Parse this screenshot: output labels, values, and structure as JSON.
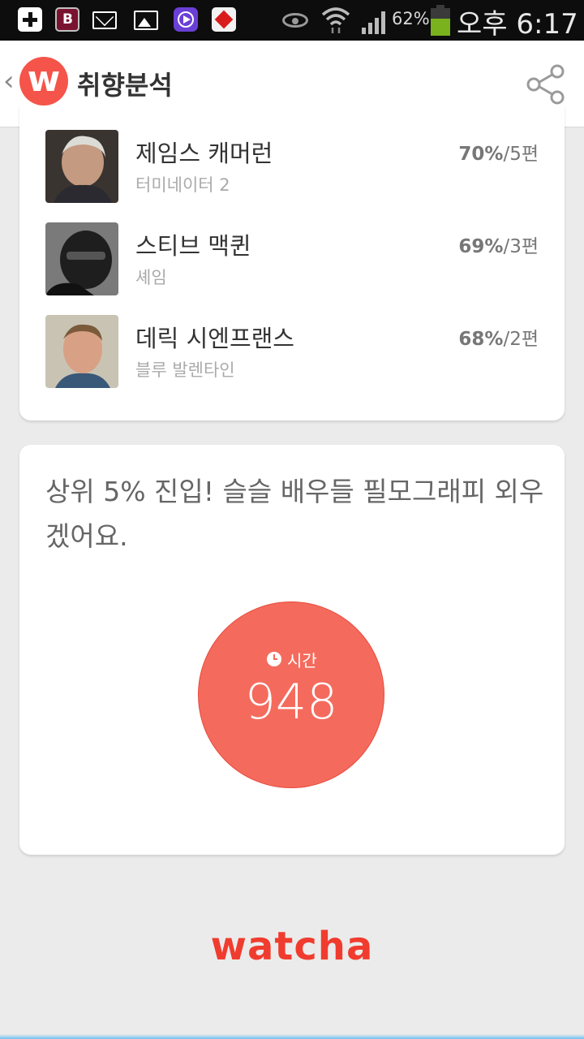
{
  "status_bar": {
    "battery_percent": "62%",
    "battery_level": 0.62,
    "time": "오후 6:17",
    "icons": [
      "add-icon",
      "b-app-icon",
      "mail-icon",
      "gallery-icon",
      "video-player-icon",
      "red-cube-app-icon",
      "eye-icon",
      "wifi-icon",
      "signal-icon",
      "battery-icon"
    ]
  },
  "app_bar": {
    "back": "‹",
    "logo_letter": "w",
    "title": "취향분석",
    "share_icon": "share-icon"
  },
  "directors": [
    {
      "name": "제임스 캐머런",
      "work": "터미네이터 2",
      "pct": "70%",
      "count": "/5편"
    },
    {
      "name": "스티브 맥퀸",
      "work": "셰임",
      "pct": "69%",
      "count": "/3편"
    },
    {
      "name": "데릭 시엔프랜스",
      "work": "블루 발렌타인",
      "pct": "68%",
      "count": "/2편"
    }
  ],
  "stat_card": {
    "message": "상위 5% 진입! 슬슬 배우들 필모그래피 외우겠어요.",
    "label": "시간",
    "value": "948"
  },
  "footer": {
    "brand": "watcha"
  },
  "colors": {
    "accent": "#f46b5d",
    "brand": "#f03c2e"
  }
}
